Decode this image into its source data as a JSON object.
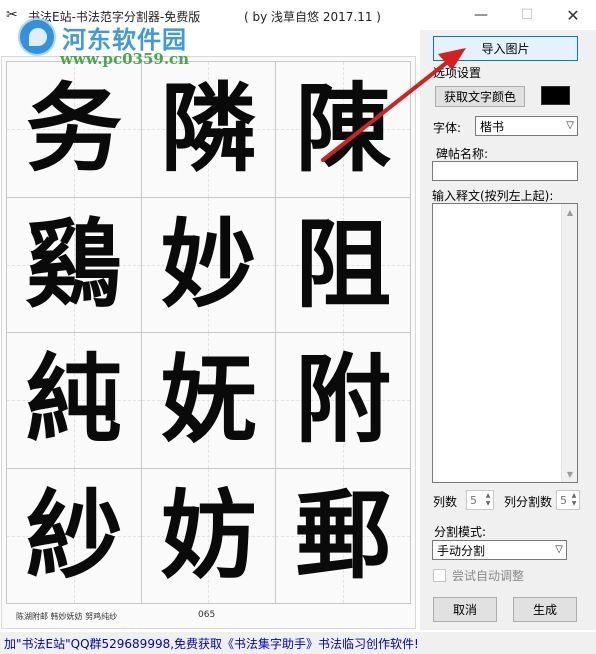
{
  "window": {
    "title": "书法E站-书法范字分割器-免费版",
    "author": "( by 浅草自悠 2017.11 )",
    "icon": "scissors-icon",
    "minimize_icon": "minimize-icon",
    "maximize_icon": "maximize-icon",
    "close_icon": "close-icon"
  },
  "watermark": {
    "title": "河东软件园",
    "url": "www.pc0359.cn"
  },
  "image": {
    "characters": [
      "务",
      "隣",
      "陳",
      "鷄",
      "妙",
      "阻",
      "純",
      "妩",
      "附",
      "紗",
      "妨",
      "郵"
    ],
    "footer_caption": "陈湖附邮 韩妙妩妨 努鸡纯纱",
    "page_number": "065"
  },
  "panel": {
    "import_button": "导入图片",
    "options_group": "选项设置",
    "get_color_button": "获取文字颜色",
    "text_color": "#000000",
    "font_label": "字体:",
    "font_value": "楷书",
    "tablet_label": "碑帖名称:",
    "tablet_value": "",
    "text_label": "输入释文(按列左上起):",
    "text_value": "",
    "cols_label": "列数",
    "cols_value": "5",
    "splits_label": "列分割数",
    "splits_value": "5",
    "mode_label": "分割模式:",
    "mode_value": "手动分割",
    "auto_adjust_label": "尝试自动调整",
    "cancel_button": "取消",
    "generate_button": "生成"
  },
  "status": {
    "text": "加\"书法E站\"QQ群529689998,免费获取《书法集字助手》书法临习创作软件!"
  },
  "annotation": {
    "arrow_color": "#d42020"
  }
}
